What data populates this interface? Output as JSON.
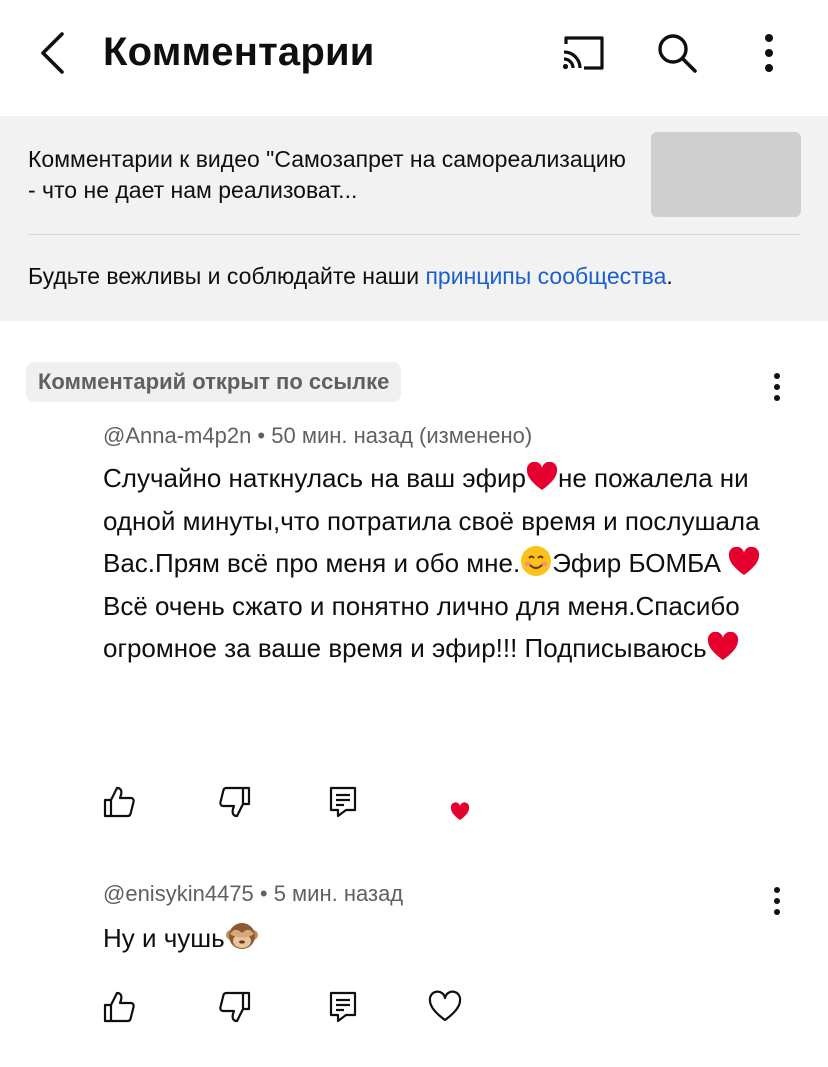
{
  "header": {
    "title": "Комментарии",
    "icons": [
      "back-icon",
      "cast-icon",
      "search-icon",
      "more-vertical-icon"
    ]
  },
  "info": {
    "video_title": "Комментарии к видео \"Самозапрет на самореализацию - что не дает нам реализоват...",
    "rules_prefix": "Будьте вежливы и соблюдайте наши ",
    "rules_link": "принципы сообщества",
    "rules_suffix": "."
  },
  "comments": [
    {
      "badge": "Комментарий открыт по ссылке",
      "author": "@Anna-m4p2n",
      "time": "50 мин. назад (изменено)",
      "text_parts": [
        "Случайно наткнулась на ваш эфир",
        "не пожалела ни одной минуты,что потратила своё время и послушала Вас.Прям всё про меня и обо мне.",
        "Эфир БОМБА ",
        "Всё очень сжато и понятно лично для меня.Спасибо огромное за ваше время и эфир!!! Подписываюсь"
      ],
      "creator_heart": true
    },
    {
      "author": "@enisykin4475",
      "time": "5 мин. назад",
      "text": "Ну и чушь",
      "creator_heart": false
    }
  ],
  "colors": {
    "accent_link": "#1a5fd0",
    "heart_red": "#e6002e",
    "panel_bg": "#f2f2f2",
    "secondary_text": "#606060"
  },
  "separator": " • "
}
